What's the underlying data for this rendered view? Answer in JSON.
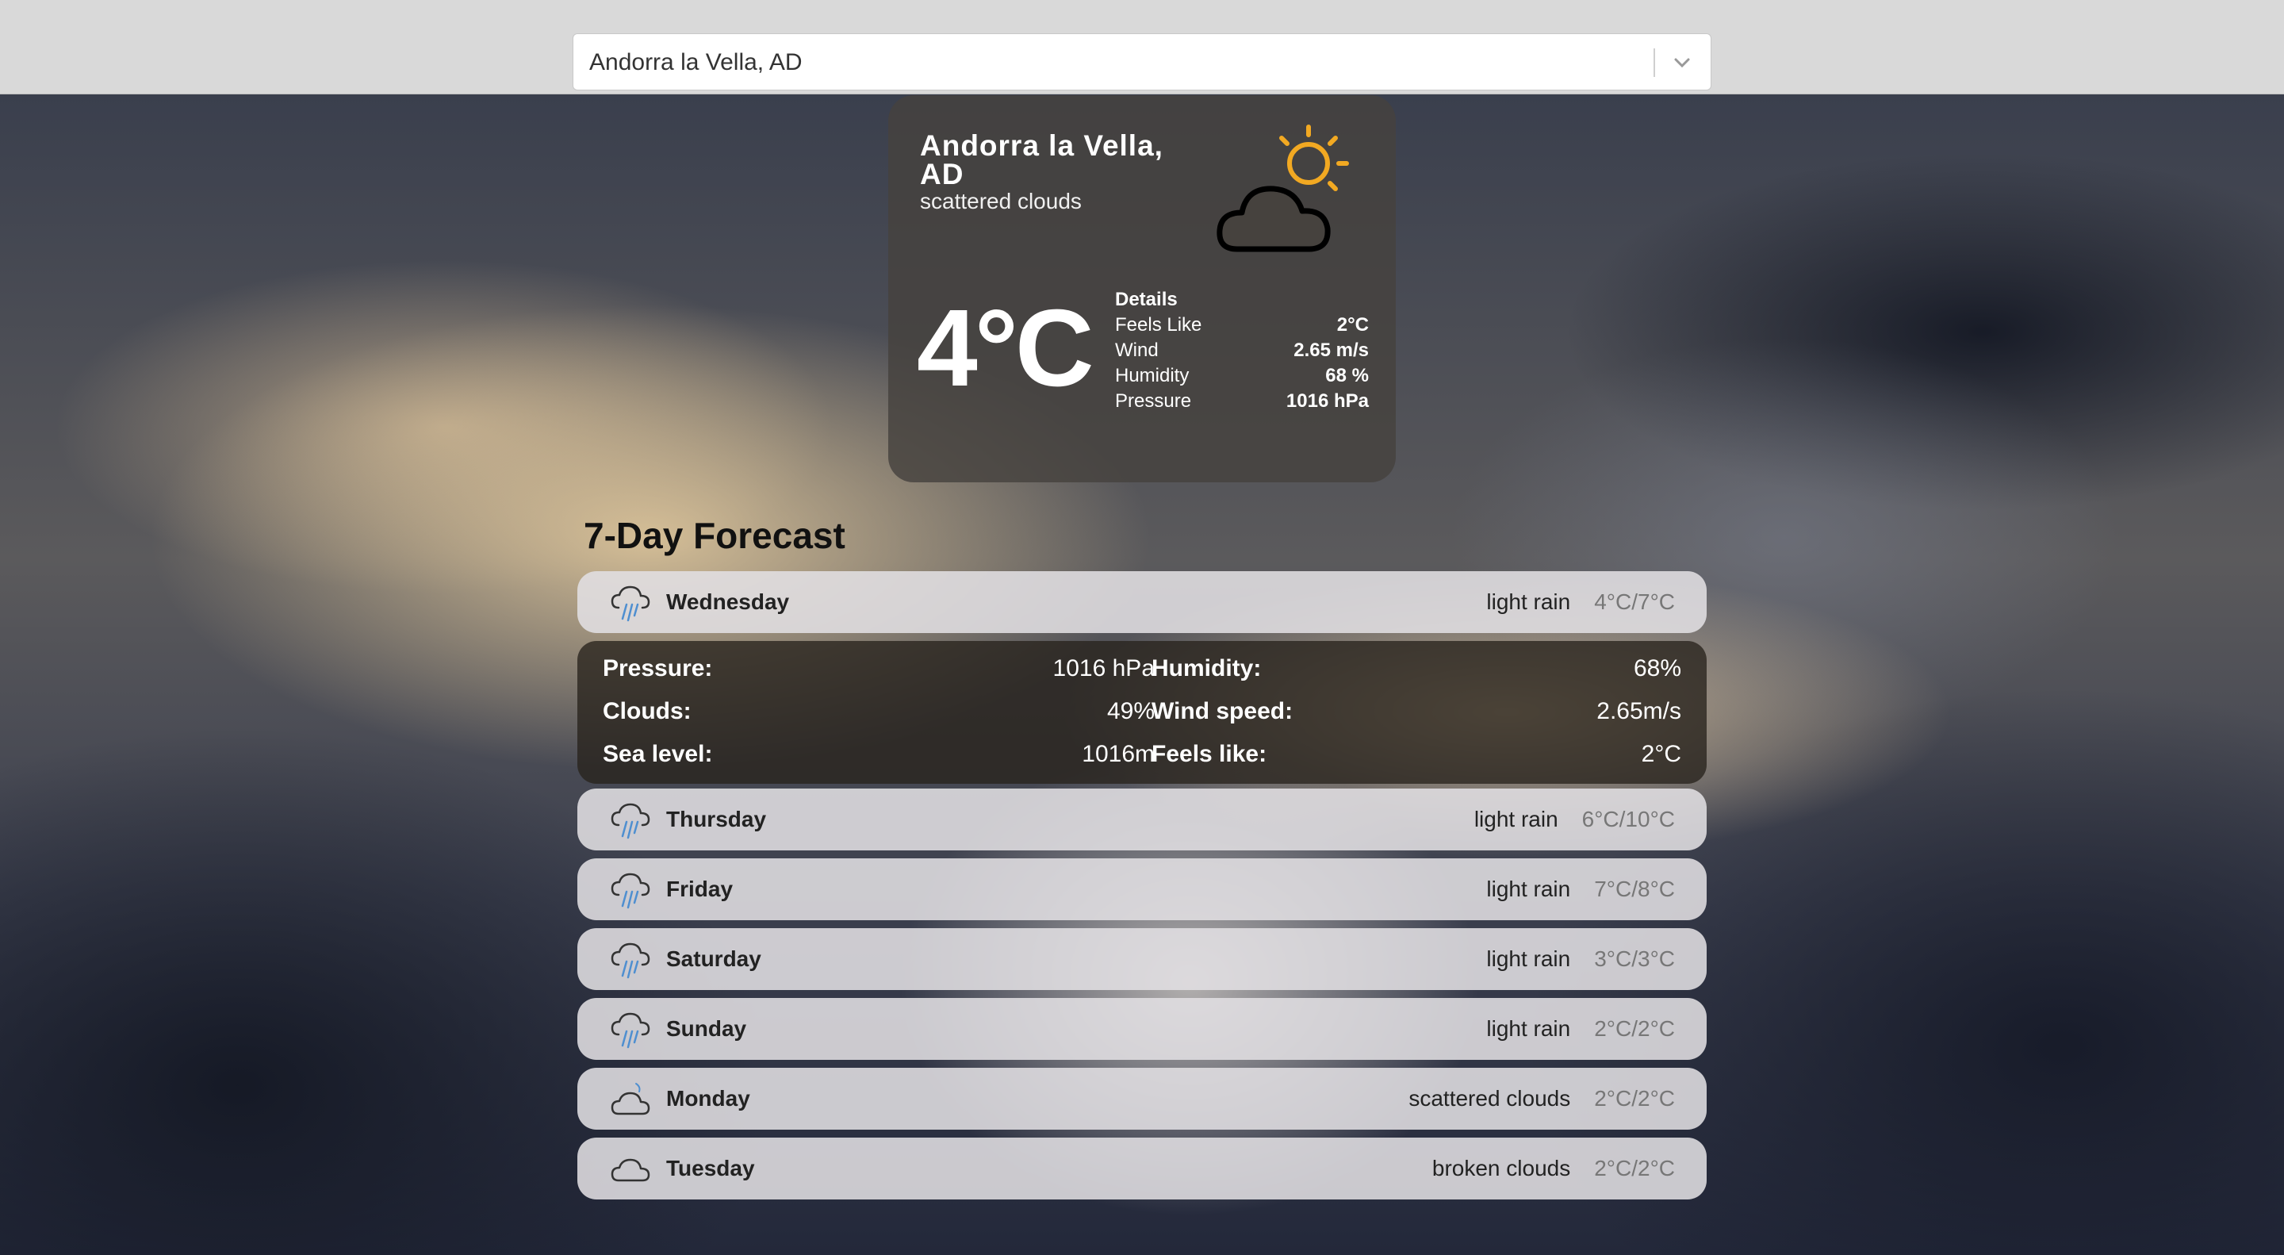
{
  "search": {
    "value": "Andorra la Vella, AD"
  },
  "current": {
    "city": "Andorra la Vella, AD",
    "description": "scattered clouds",
    "temperature": "4°C",
    "icon": "sun-behind-cloud-icon",
    "details_title": "Details",
    "details": [
      {
        "label": "Feels Like",
        "value": "2°C"
      },
      {
        "label": "Wind",
        "value": "2.65 m/s"
      },
      {
        "label": "Humidity",
        "value": "68 %"
      },
      {
        "label": "Pressure",
        "value": "1016 hPa"
      }
    ]
  },
  "forecast": {
    "title": "7-Day Forecast",
    "days": [
      {
        "day": "Wednesday",
        "desc": "light rain",
        "temp": "4°C/7°C",
        "icon": "rain-cloud-icon"
      },
      {
        "day": "Thursday",
        "desc": "light rain",
        "temp": "6°C/10°C",
        "icon": "rain-cloud-icon"
      },
      {
        "day": "Friday",
        "desc": "light rain",
        "temp": "7°C/8°C",
        "icon": "rain-cloud-icon"
      },
      {
        "day": "Saturday",
        "desc": "light rain",
        "temp": "3°C/3°C",
        "icon": "rain-cloud-icon"
      },
      {
        "day": "Sunday",
        "desc": "light rain",
        "temp": "2°C/2°C",
        "icon": "rain-cloud-icon"
      },
      {
        "day": "Monday",
        "desc": "scattered clouds",
        "temp": "2°C/2°C",
        "icon": "cloud-icon"
      },
      {
        "day": "Tuesday",
        "desc": "broken clouds",
        "temp": "2°C/2°C",
        "icon": "cloud-icon"
      }
    ],
    "expanded": [
      {
        "label": "Pressure:",
        "value": "1016 hPa"
      },
      {
        "label": "Humidity:",
        "value": "68%"
      },
      {
        "label": "Clouds:",
        "value": "49%"
      },
      {
        "label": "Wind speed:",
        "value": "2.65m/s"
      },
      {
        "label": "Sea level:",
        "value": "1016m"
      },
      {
        "label": "Feels like:",
        "value": "2°C"
      }
    ]
  },
  "colors": {
    "card_bg": "#46423e",
    "row_bg": "#e1dfe2",
    "sun": "#f2a922",
    "rain": "#4f8fd0"
  }
}
